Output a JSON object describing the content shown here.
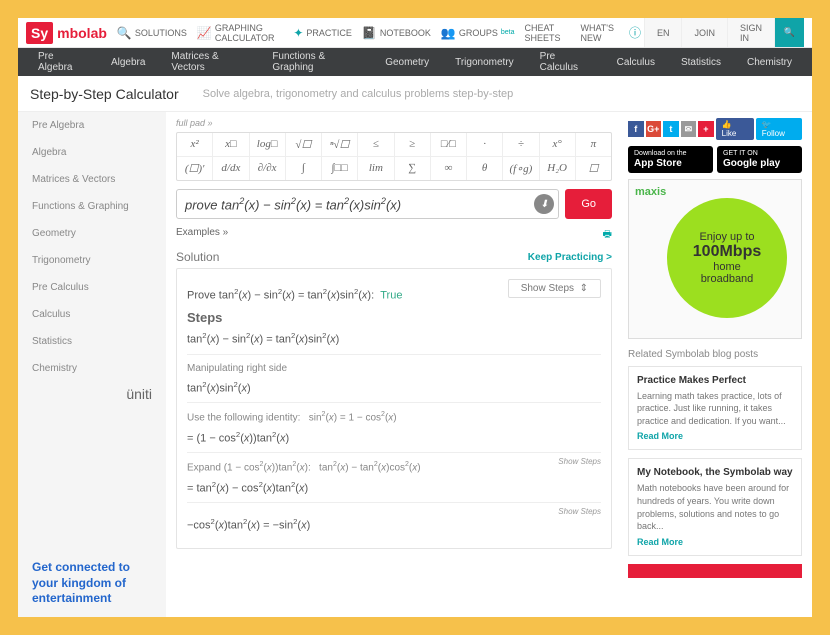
{
  "brand": {
    "part1": "Sy",
    "part2": "mbolab"
  },
  "topnav": [
    {
      "icon": "🔍",
      "label": "SOLUTIONS"
    },
    {
      "icon": "📈",
      "label": "GRAPHING CALCULATOR"
    },
    {
      "icon": "✦",
      "label": "PRACTICE"
    },
    {
      "icon": "📓",
      "label": "NOTEBOOK"
    },
    {
      "icon": "👥",
      "label": "GROUPS",
      "sub": "beta"
    },
    {
      "icon": "",
      "label": "CHEAT SHEETS"
    },
    {
      "icon": "",
      "label": "WHAT'S NEW"
    },
    {
      "icon": "ⓘ",
      "label": ""
    }
  ],
  "topright": {
    "lang": "EN",
    "join": "JOIN",
    "signin": "SIGN IN"
  },
  "subjects": [
    "Pre Algebra",
    "Algebra",
    "Matrices & Vectors",
    "Functions & Graphing",
    "Geometry",
    "Trigonometry",
    "Pre Calculus",
    "Calculus",
    "Statistics",
    "Chemistry"
  ],
  "title": {
    "main": "Step-by-Step Calculator",
    "sub": "Solve algebra, trigonometry and calculus problems step-by-step"
  },
  "sidebar": [
    "Pre Algebra",
    "Algebra",
    "Matrices & Vectors",
    "Functions & Graphing",
    "Geometry",
    "Trigonometry",
    "Pre Calculus",
    "Calculus",
    "Statistics",
    "Chemistry"
  ],
  "sidead": {
    "brand": "üniti",
    "text": "Get connected to your kingdom of entertainment"
  },
  "fullpad": "full pad »",
  "keypad": {
    "row1": [
      "x²",
      "x□",
      "log□",
      "√☐",
      "ⁿ√☐",
      "≤",
      "≥",
      "□⁄□",
      "·",
      "÷",
      "x°",
      "π"
    ],
    "row2": [
      "(☐)′",
      "d/dx",
      "∂/∂x",
      "∫",
      "∫□□",
      "lim",
      "∑",
      "∞",
      "θ",
      "(f∘g)",
      "H₂O",
      "☐"
    ]
  },
  "expression": "prove tan²(x) − sin²(x) = tan²(x)sin²(x)",
  "go": "Go",
  "examples": "Examples »",
  "solution": {
    "header": "Solution",
    "keep": "Keep Practicing >",
    "showsteps": "Show Steps",
    "prove_label": "Prove",
    "prove_eq": "tan²(x) − sin²(x) = tan²(x)sin²(x):",
    "prove_result": "True",
    "steps": "Steps",
    "eq1": "tan²(x) − sin²(x) = tan²(x)sin²(x)",
    "manip": "Manipulating right side",
    "eq2": "tan²(x)sin²(x)",
    "ident": "Use the following identity:",
    "ident_eq": "sin²(x) = 1 − cos²(x)",
    "eq3": "= (1 − cos²(x))tan²(x)",
    "expand": "Expand",
    "expand_eq": "(1 − cos²(x))tan²(x):",
    "expand_r": "tan²(x) − tan²(x)cos²(x)",
    "eq4": "= tan²(x) − cos²(x)tan²(x)",
    "eq5": "−cos²(x)tan²(x) = −sin²(x)",
    "ss": "Show Steps"
  },
  "social": {
    "like": "👍 Like",
    "follow": "🐦 Follow"
  },
  "stores": {
    "app": {
      "l1": "Download on the",
      "l2": "App Store"
    },
    "play": {
      "l1": "GET IT ON",
      "l2": "Google play"
    }
  },
  "ad": {
    "brand": "maxis",
    "l1": "Enjoy up to",
    "l2": "100Mbps",
    "l3": "home",
    "l4": "broadband"
  },
  "related": "Related Symbolab blog posts",
  "blogs": [
    {
      "title": "Practice Makes Perfect",
      "body": "Learning math takes practice, lots of practice. Just like running, it takes practice and dedication. If you want...",
      "read": "Read More"
    },
    {
      "title": "My Notebook, the Symbolab way",
      "body": "Math notebooks have been around for hundreds of years. You write down problems, solutions and notes to go back...",
      "read": "Read More"
    }
  ]
}
